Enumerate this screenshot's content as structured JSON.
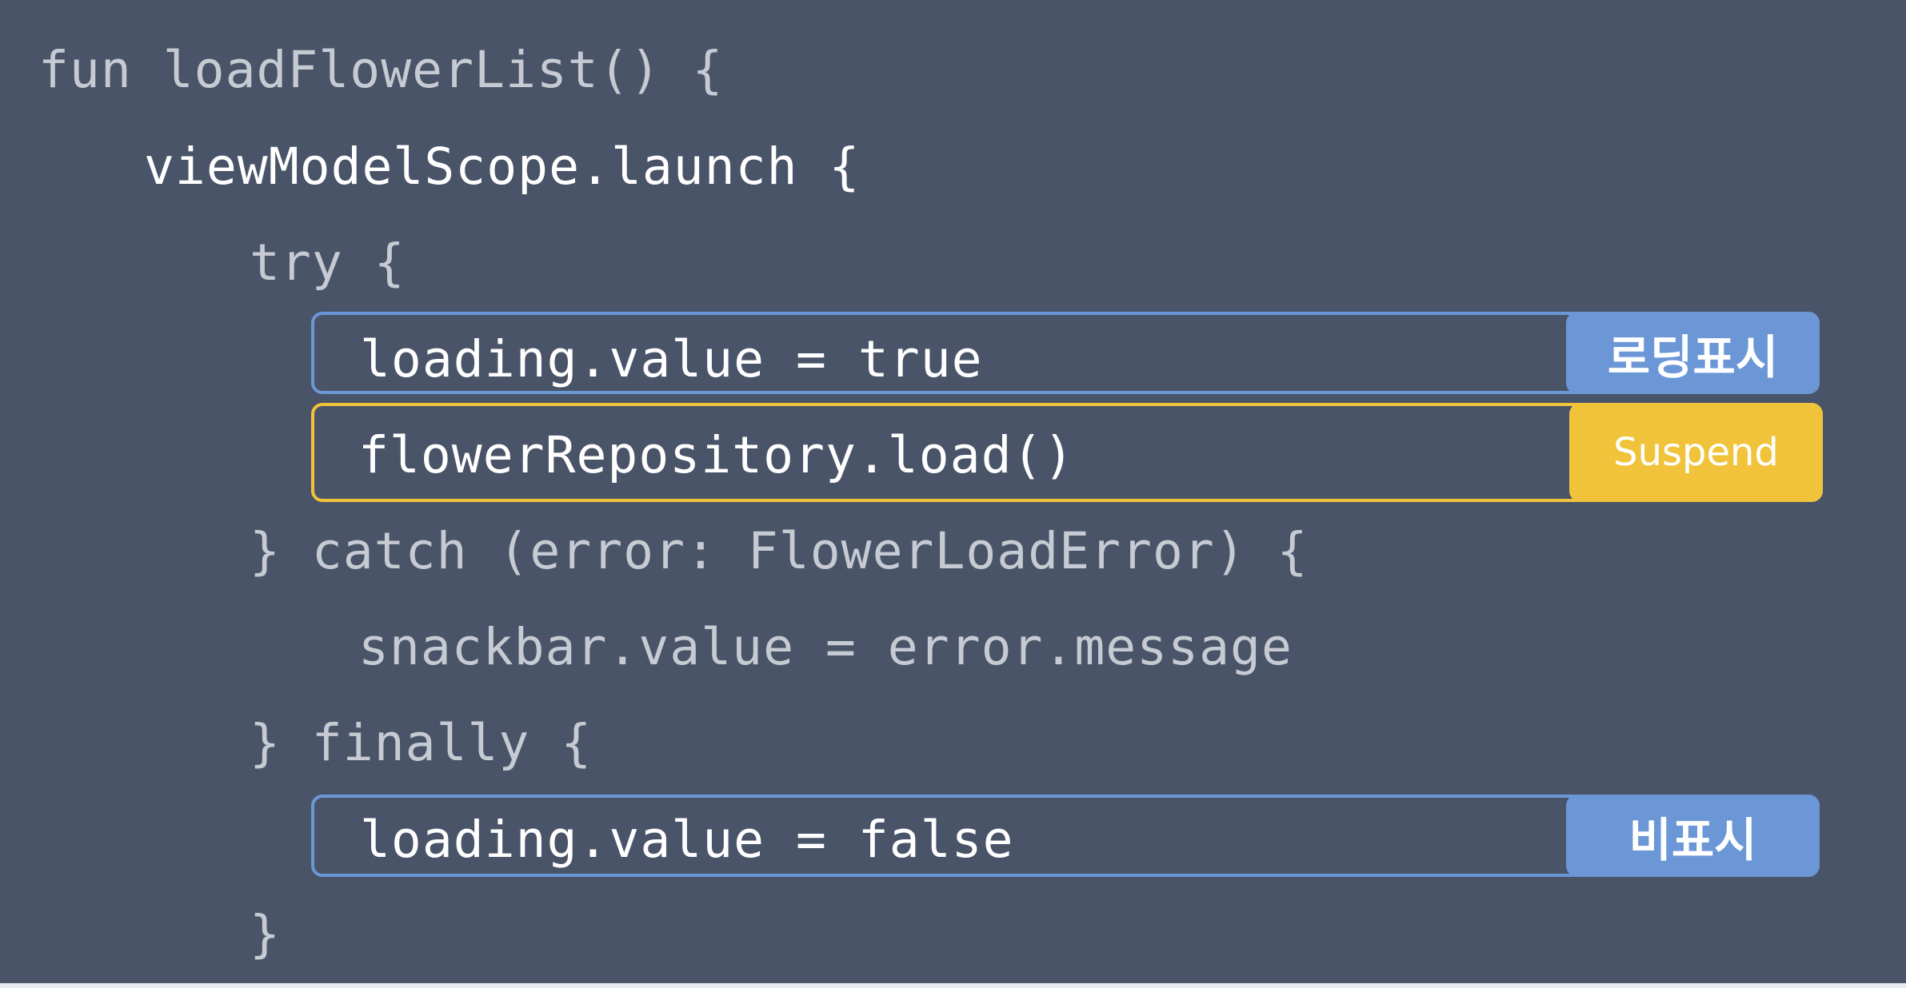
{
  "code": {
    "lines": [
      "fun loadFlowerList() {",
      "viewModelScope.launch {",
      "try {",
      "loading.value = true",
      "flowerRepository.load()",
      "} catch (error: FlowerLoadError) {",
      "snackbar.value = error.message",
      "} finally {",
      "loading.value = false",
      "}"
    ]
  },
  "badges": {
    "show_loading": "로딩표시",
    "suspend": "Suspend",
    "hide": "비표시"
  },
  "colors": {
    "background": "#4a5468",
    "code_dim": "#c6cad2",
    "code_bright": "#ffffff",
    "blue_accent": "#6b97d6",
    "yellow_accent": "#f0c33a"
  }
}
